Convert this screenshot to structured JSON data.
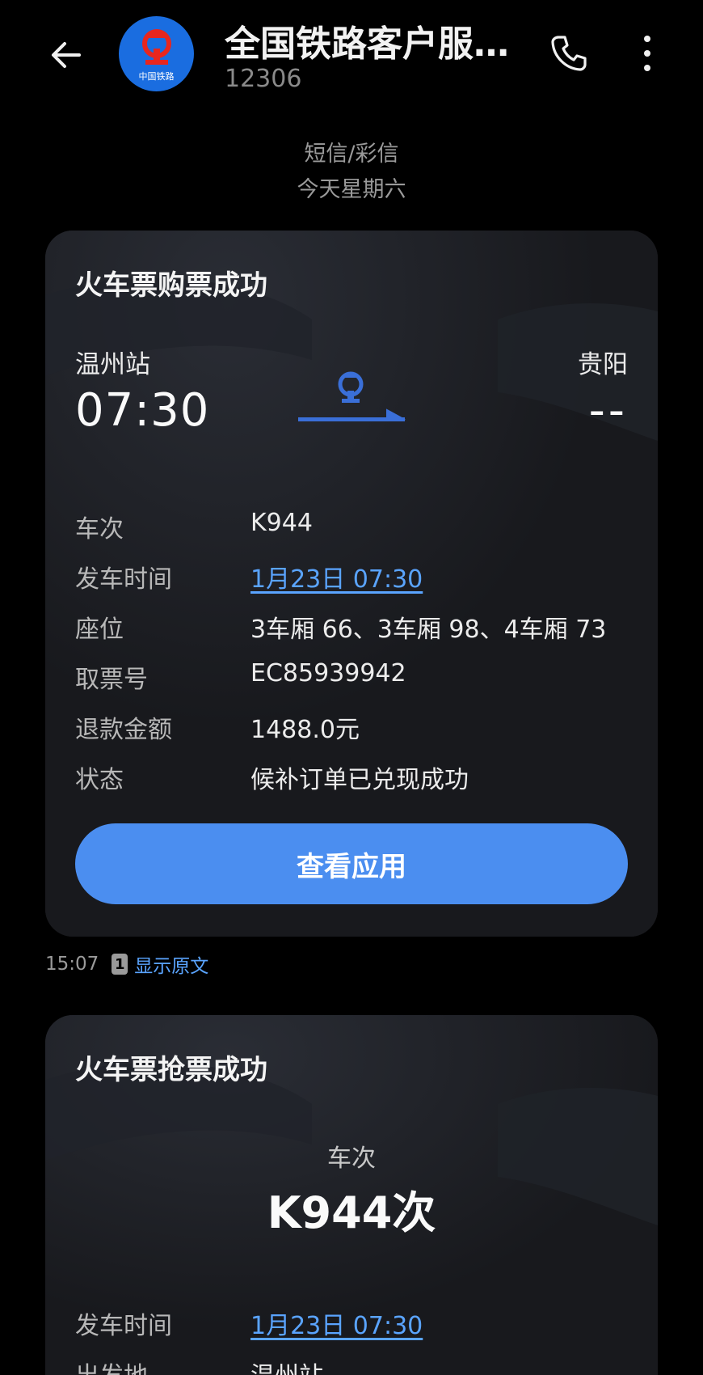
{
  "header": {
    "title": "全国铁路客户服…",
    "number": "12306",
    "avatar_caption": "中国铁路"
  },
  "thread": {
    "message_type": "短信/彩信",
    "date": "今天星期六"
  },
  "card1": {
    "title": "火车票购票成功",
    "from_station": "温州站",
    "from_time": "07:30",
    "to_station": "贵阳",
    "to_time": "--",
    "rows": [
      {
        "label": "车次",
        "value": "K944"
      },
      {
        "label": "发车时间",
        "value": "1月23日 07:30"
      },
      {
        "label": "座位",
        "value": "3车厢 66、3车厢 98、4车厢 73"
      },
      {
        "label": "取票号",
        "value": "EC85939942"
      },
      {
        "label": "退款金额",
        "value": "1488.0元"
      },
      {
        "label": "状态",
        "value": "候补订单已兑现成功"
      }
    ],
    "button_label": "查看应用"
  },
  "message_footer": {
    "time": "15:07",
    "sim": "1",
    "show_original": "显示原文"
  },
  "card2": {
    "title": "火车票抢票成功",
    "train_label": "车次",
    "train_number": "K944次",
    "rows": [
      {
        "label": "发车时间",
        "value": "1月23日 07:30"
      },
      {
        "label": "出发地",
        "value": "温州站"
      }
    ]
  },
  "colors": {
    "accent": "#4b8ef0",
    "link": "#5aa4ff",
    "card_bg": "#18191d",
    "logo_blue": "#1a6de0",
    "route_blue": "#3a6fd8"
  },
  "icons": [
    "back-arrow-icon",
    "railway-logo-icon",
    "phone-icon",
    "more-vertical-icon",
    "sim-card-icon"
  ]
}
